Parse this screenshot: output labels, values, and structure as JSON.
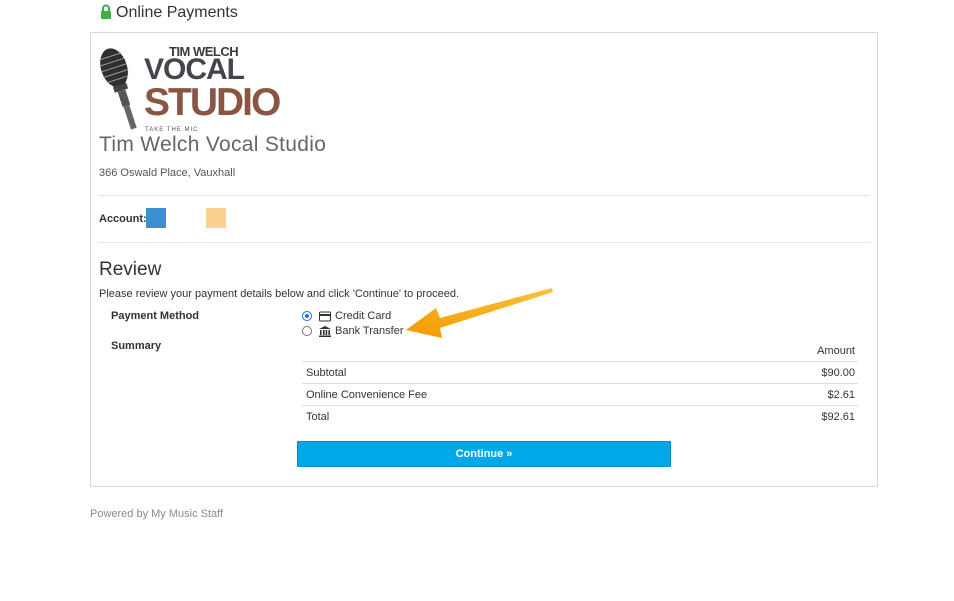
{
  "header": {
    "title": "Online Payments",
    "icon": "lock-icon"
  },
  "studio": {
    "logo": {
      "line1": "TIM WELCH",
      "line2": "VOCAL",
      "line3": "STUDIO",
      "tagline": "TAKE THE MIC"
    },
    "name": "Tim Welch Vocal Studio",
    "address": "366 Oswald Place, Vauxhall"
  },
  "account": {
    "label": "Account:",
    "swatches": [
      "#3a8fd0",
      "#fdd08f"
    ]
  },
  "review": {
    "title": "Review",
    "intro": "Please review your payment details below and click 'Continue' to proceed.",
    "payment_method_label": "Payment Method",
    "payment_methods": [
      {
        "label": "Credit Card",
        "icon": "credit-card-icon",
        "selected": true
      },
      {
        "label": "Bank Transfer",
        "icon": "bank-icon",
        "selected": false
      }
    ],
    "summary_label": "Summary",
    "summary": {
      "amount_header": "Amount",
      "rows": [
        {
          "label": "Subtotal",
          "amount": "$90.00"
        },
        {
          "label": "Online Convenience Fee",
          "amount": "$2.61"
        },
        {
          "label": "Total",
          "amount": "$92.61"
        }
      ]
    },
    "continue_label": "Continue"
  },
  "footer": {
    "powered_by": "Powered by My Music Staff"
  },
  "colors": {
    "button": "#00a8e8",
    "lock": "#3cb043",
    "annotation_arrow": "#f5a300"
  }
}
